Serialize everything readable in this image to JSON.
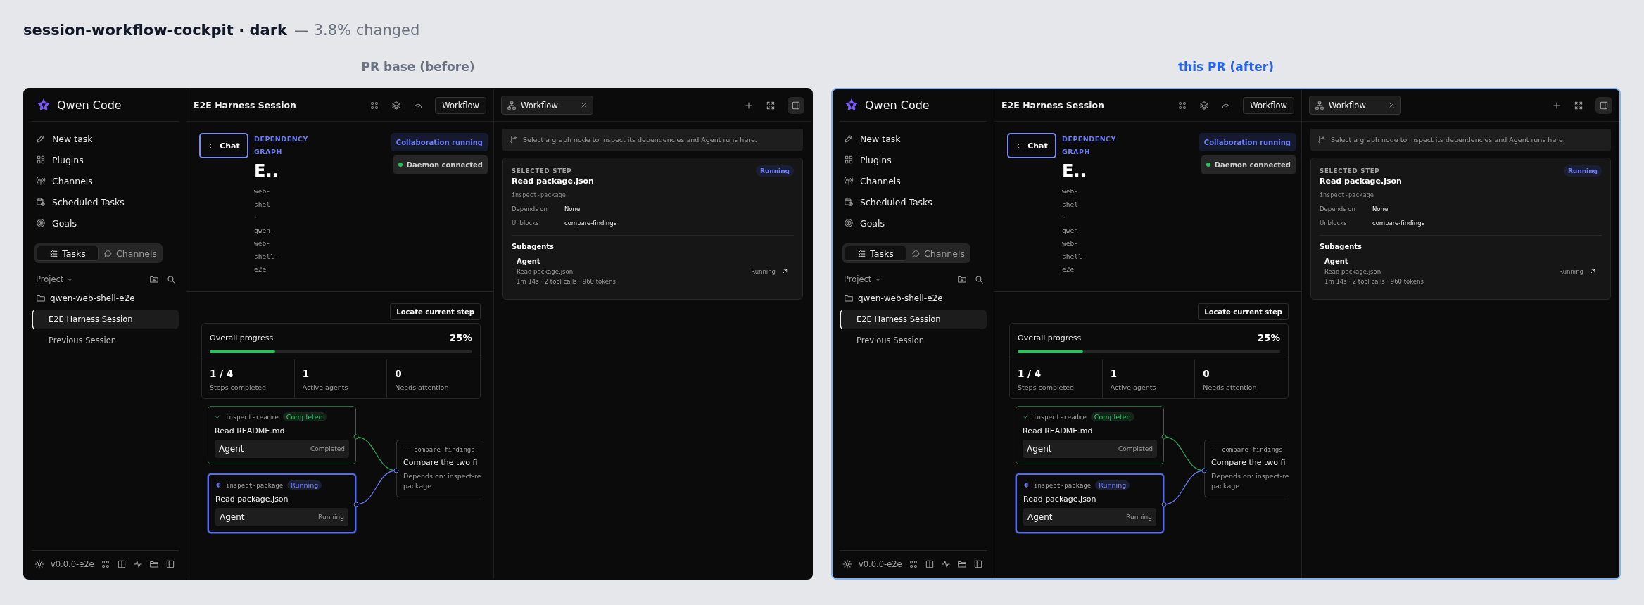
{
  "page": {
    "title": "session-workflow-cockpit · dark",
    "subtitle": "— 3.8% changed"
  },
  "panels": [
    {
      "label": "PR base (before)",
      "highlighted": false,
      "app": {
        "sidebar": {
          "brand": "Qwen Code",
          "nav": [
            {
              "label": "New task"
            },
            {
              "label": "Plugins"
            },
            {
              "label": "Channels"
            },
            {
              "label": "Scheduled Tasks"
            },
            {
              "label": "Goals"
            }
          ],
          "segments": [
            {
              "label": "Tasks",
              "selected": true
            },
            {
              "label": "Channels",
              "selected": false
            }
          ],
          "project_label": "Project",
          "folder": "qwen-web-shell-e2e",
          "sessions": [
            {
              "label": "E2E Harness Session",
              "selected": true
            },
            {
              "label": "Previous Session",
              "selected": false
            }
          ],
          "version": "v0.0.0-e2e"
        },
        "main": {
          "title": "E2E Harness Session",
          "view_button": "Workflow",
          "back_button": "Chat",
          "eyebrow": "DEPENDENCY GRAPH",
          "badges": [
            {
              "label": "Collaboration running",
              "kind": "info"
            },
            {
              "label": "Daemon connected",
              "kind": "success"
            }
          ],
          "heading": "E..",
          "subtitle_lines": [
            "web-",
            "shel",
            "·",
            "qwen-",
            "web-",
            "shell-",
            "e2e"
          ],
          "locate_button": "Locate current step",
          "progress": {
            "label": "Overall progress",
            "percent": "25%",
            "level": 0.25
          },
          "stats": [
            {
              "value": "1 / 4",
              "label": "Steps completed"
            },
            {
              "value": "1",
              "label": "Active agents"
            },
            {
              "value": "0",
              "label": "Needs attention"
            }
          ],
          "nodes": [
            {
              "id": "inspect-readme",
              "kind": "completed",
              "status_label": "Completed",
              "title": "Read README.md",
              "agent": "Agent",
              "agent_status": "Completed",
              "selected": false
            },
            {
              "id": "inspect-package",
              "kind": "running",
              "status_label": "Running",
              "title": "Read package.json",
              "agent": "Agent",
              "agent_status": "Running",
              "selected": true
            },
            {
              "id": "compare-findings",
              "kind": "pending",
              "title": "Compare the two fi",
              "details": [
                "Depends on: inspect-re",
                "package"
              ],
              "selected": false
            }
          ]
        },
        "inspector": {
          "tab": "Workflow",
          "hint": "Select a graph node to inspect its dependencies and Agent runs here.",
          "eyebrow": "SELECTED STEP",
          "status": "Running",
          "title": "Read package.json",
          "step_id": "inspect-package",
          "fields": [
            {
              "label": "Depends on",
              "value": "None"
            },
            {
              "label": "Unblocks",
              "value": "compare-findings"
            }
          ],
          "subagents_title": "Subagents",
          "subagents": [
            {
              "name": "Agent",
              "task": "Read package.json",
              "meta": "1m 14s · 2 tool calls · 960 tokens",
              "status": "Running"
            }
          ]
        }
      }
    },
    {
      "label": "this PR (after)",
      "highlighted": true,
      "app": {
        "sidebar": {
          "brand": "Qwen Code",
          "nav": [
            {
              "label": "New task"
            },
            {
              "label": "Plugins"
            },
            {
              "label": "Channels"
            },
            {
              "label": "Scheduled Tasks"
            },
            {
              "label": "Goals"
            }
          ],
          "segments": [
            {
              "label": "Tasks",
              "selected": true
            },
            {
              "label": "Channels",
              "selected": false
            }
          ],
          "project_label": "Project",
          "folder": "qwen-web-shell-e2e",
          "sessions": [
            {
              "label": "E2E Harness Session",
              "selected": true
            },
            {
              "label": "Previous Session",
              "selected": false
            }
          ],
          "version": "v0.0.0-e2e"
        },
        "main": {
          "title": "E2E Harness Session",
          "view_button": "Workflow",
          "back_button": "Chat",
          "eyebrow": "DEPENDENCY GRAPH",
          "badges": [
            {
              "label": "Collaboration running",
              "kind": "info"
            },
            {
              "label": "Daemon connected",
              "kind": "success"
            }
          ],
          "heading": "E..",
          "subtitle_lines": [
            "web-",
            "shel",
            "·",
            "qwen-",
            "web-",
            "shell-",
            "e2e"
          ],
          "locate_button": "Locate current step",
          "progress": {
            "label": "Overall progress",
            "percent": "25%",
            "level": 0.25
          },
          "stats": [
            {
              "value": "1 / 4",
              "label": "Steps completed"
            },
            {
              "value": "1",
              "label": "Active agents"
            },
            {
              "value": "0",
              "label": "Needs attention"
            }
          ],
          "nodes": [
            {
              "id": "inspect-readme",
              "kind": "completed",
              "status_label": "Completed",
              "title": "Read README.md",
              "agent": "Agent",
              "agent_status": "Completed",
              "selected": false
            },
            {
              "id": "inspect-package",
              "kind": "running",
              "status_label": "Running",
              "title": "Read package.json",
              "agent": "Agent",
              "agent_status": "Running",
              "selected": true
            },
            {
              "id": "compare-findings",
              "kind": "pending",
              "title": "Compare the two fi",
              "details": [
                "Depends on: inspect-re",
                "package"
              ],
              "selected": false
            }
          ]
        },
        "inspector": {
          "tab": "Workflow",
          "hint": "Select a graph node to inspect its dependencies and Agent runs here.",
          "eyebrow": "SELECTED STEP",
          "status": "Running",
          "title": "Read package.json",
          "step_id": "inspect-package",
          "fields": [
            {
              "label": "Depends on",
              "value": "None"
            },
            {
              "label": "Unblocks",
              "value": "compare-findings"
            }
          ],
          "subagents_title": "Subagents",
          "subagents": [
            {
              "name": "Agent",
              "task": "Read package.json",
              "meta": "1m 14s · 2 tool calls · 960 tokens",
              "status": "Running"
            }
          ]
        }
      }
    }
  ]
}
